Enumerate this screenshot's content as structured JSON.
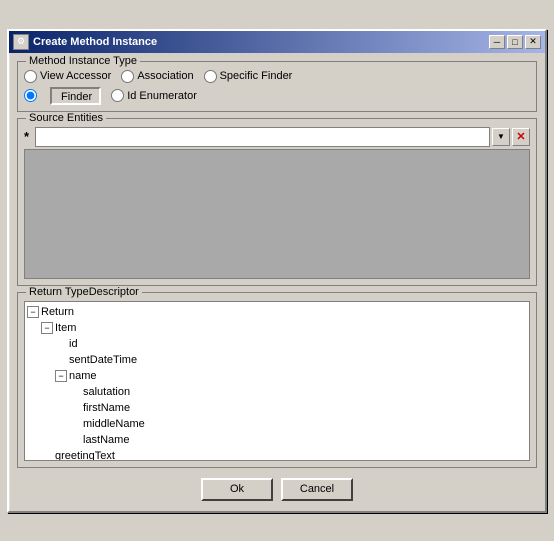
{
  "window": {
    "title": "Create Method Instance",
    "title_btn_min": "─",
    "title_btn_max": "□",
    "title_btn_close": "✕"
  },
  "method_instance_type": {
    "label": "Method Instance Type",
    "options": [
      {
        "id": "opt-view-accessor",
        "label": "View Accessor",
        "checked": false
      },
      {
        "id": "opt-association",
        "label": "Association",
        "checked": false
      },
      {
        "id": "opt-specific-finder",
        "label": "Specific Finder",
        "checked": false
      },
      {
        "id": "opt-finder",
        "label": "Finder",
        "checked": true
      },
      {
        "id": "opt-id-enumerator",
        "label": "Id Enumerator",
        "checked": false
      }
    ],
    "finder_button_label": "Finder"
  },
  "source_entities": {
    "label": "Source Entities",
    "star": "*",
    "dropdown_char": "▼",
    "delete_char": "✕"
  },
  "return_type": {
    "label": "Return TypeDescriptor",
    "tree": [
      {
        "id": "node-return",
        "label": "Return",
        "depth": 0,
        "expanded": true,
        "has_children": true
      },
      {
        "id": "node-item",
        "label": "Item",
        "depth": 1,
        "expanded": true,
        "has_children": true
      },
      {
        "id": "node-id",
        "label": "id",
        "depth": 2,
        "expanded": false,
        "has_children": false
      },
      {
        "id": "node-sentdatetime",
        "label": "sentDateTime",
        "depth": 2,
        "expanded": false,
        "has_children": false
      },
      {
        "id": "node-name",
        "label": "name",
        "depth": 2,
        "expanded": true,
        "has_children": true
      },
      {
        "id": "node-salutation",
        "label": "salutation",
        "depth": 3,
        "expanded": false,
        "has_children": false
      },
      {
        "id": "node-firstname",
        "label": "firstName",
        "depth": 3,
        "expanded": false,
        "has_children": false
      },
      {
        "id": "node-middlename",
        "label": "middleName",
        "depth": 3,
        "expanded": false,
        "has_children": false
      },
      {
        "id": "node-lastname",
        "label": "lastName",
        "depth": 3,
        "expanded": false,
        "has_children": false
      },
      {
        "id": "node-greetingtext",
        "label": "greetingText",
        "depth": 1,
        "expanded": false,
        "has_children": false
      }
    ]
  },
  "buttons": {
    "ok": "Ok",
    "cancel": "Cancel"
  }
}
